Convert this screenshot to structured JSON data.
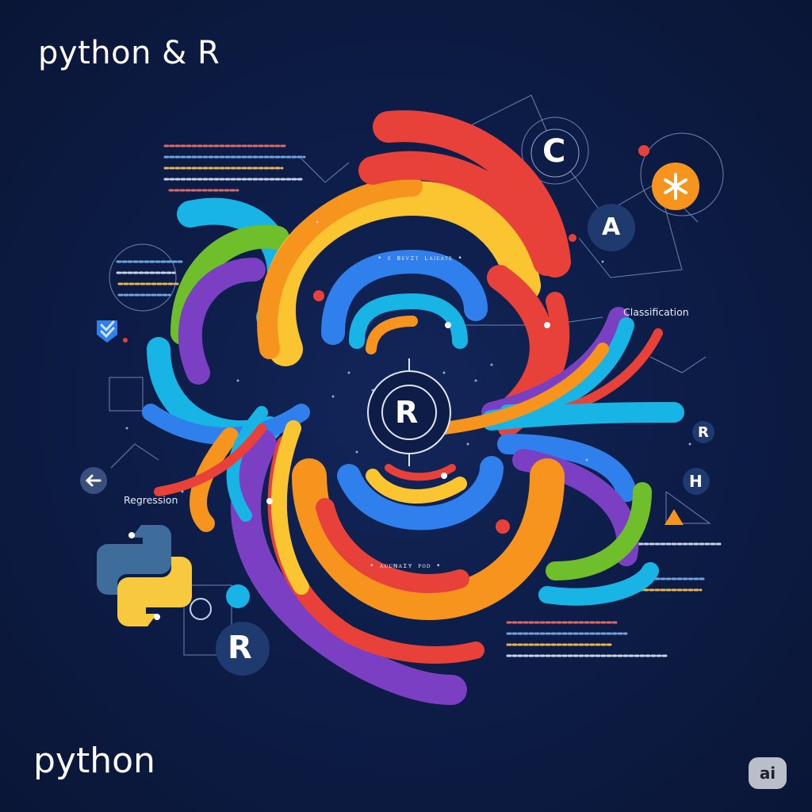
{
  "title_top": "python & R",
  "title_bottom": "python",
  "labels": {
    "classification": "Classification",
    "regression": "Regression"
  },
  "captions": {
    "top": "• ᴇ ʙᴇᴠɪᴛ ʟᴀᴊᴇᴀᴛᴇ •",
    "bottom": "• ᴀᴜᴜɴᴀɪʏ ᴘᴏᴅ •"
  },
  "badge": "ai",
  "icons": {
    "c": "C",
    "a": "A",
    "r_center": "R",
    "r_small": "R",
    "r_large": "R",
    "h": "H"
  },
  "colors": {
    "background": "#0c1a3e",
    "red": "#e8413a",
    "orange": "#f7941d",
    "yellow": "#fbc531",
    "blue": "#2f80ed",
    "cyan": "#19b4e6",
    "purple": "#7b3fc4",
    "green": "#6fbf2c",
    "python_blue": "#3e6d9c",
    "python_yellow": "#f7c93e"
  }
}
